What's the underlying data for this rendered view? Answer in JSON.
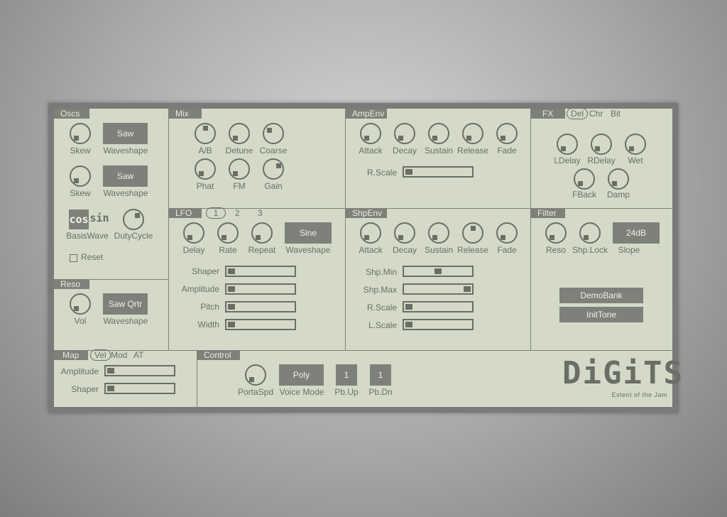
{
  "colors": {
    "panel": "#d4dac7",
    "frame": "#7a7a7a",
    "ink": "#6b6e66",
    "tab_bg": "#7e807a",
    "tab_text": "#e8ecdd"
  },
  "oscs": {
    "title": "Oscs",
    "skew1": "Skew",
    "wave1": "Waveshape",
    "wave1_val": "Saw",
    "skew2": "Skew",
    "wave2": "Waveshape",
    "wave2_val": "Saw",
    "basis_cos": "cos",
    "basis_sin": "sin",
    "basiswave": "BasisWave",
    "dutycycle": "DutyCycle",
    "reset": "Reset"
  },
  "reso": {
    "title": "Reso",
    "vol": "Vol",
    "wave": "Waveshape",
    "wave_val": "Saw Qrtr"
  },
  "mix": {
    "title": "Mix",
    "k1": "A/B",
    "k2": "Detune",
    "k3": "Coarse",
    "k4": "Phat",
    "k5": "FM",
    "k6": "Gain"
  },
  "lfo": {
    "title": "LFO",
    "tabs": [
      "1",
      "2",
      "3"
    ],
    "delay": "Delay",
    "rate": "Rate",
    "repeat": "Repeat",
    "wave": "Waveshape",
    "wave_val": "Sine",
    "sliders": [
      {
        "label": "Shaper",
        "value": 0.0
      },
      {
        "label": "Amplitude",
        "value": 0.0
      },
      {
        "label": "Pitch",
        "value": 0.0
      },
      {
        "label": "Width",
        "value": 0.0
      }
    ]
  },
  "ampenv": {
    "title": "AmpEnv",
    "attack": "Attack",
    "decay": "Decay",
    "sustain": "Sustain",
    "release": "Release",
    "fade": "Fade",
    "rscale": "R.Scale",
    "rscale_value": 0.0
  },
  "shpenv": {
    "title": "ShpEnv",
    "attack": "Attack",
    "decay": "Decay",
    "sustain": "Sustain",
    "release": "Release",
    "fade": "Fade",
    "sliders": [
      {
        "label": "Shp.Min",
        "value": 0.5
      },
      {
        "label": "Shp.Max",
        "value": 1.0
      },
      {
        "label": "R.Scale",
        "value": 0.0
      },
      {
        "label": "L.Scale",
        "value": 0.0
      }
    ]
  },
  "fx": {
    "title": "FX",
    "tabs": [
      "Del",
      "Chr",
      "Bit"
    ],
    "ldelay": "LDelay",
    "rdelay": "RDelay",
    "wet": "Wet",
    "fback": "FBack",
    "damp": "Damp"
  },
  "filter": {
    "title": "Filter",
    "reso": "Reso",
    "shplock": "Shp.Lock",
    "slope": "Slope",
    "slope_val": "24dB",
    "demobank": "DemoBank",
    "inittone": "InitTone"
  },
  "map": {
    "title": "Map",
    "tabs": [
      "Vel",
      "Mod",
      "AT"
    ],
    "amplitude": "Amplitude",
    "amplitude_value": 0.0,
    "shaper": "Shaper",
    "shaper_value": 0.0
  },
  "control": {
    "title": "Control",
    "portaspd": "PortaSpd",
    "voicemode": "Voice Mode",
    "voicemode_val": "Poly",
    "pbup": "Pb.Up",
    "pbup_val": "1",
    "pbdn": "Pb.Dn",
    "pbdn_val": "1"
  },
  "brand": {
    "logo": "DiGiTS",
    "tagline": "Extent of the Jam"
  }
}
